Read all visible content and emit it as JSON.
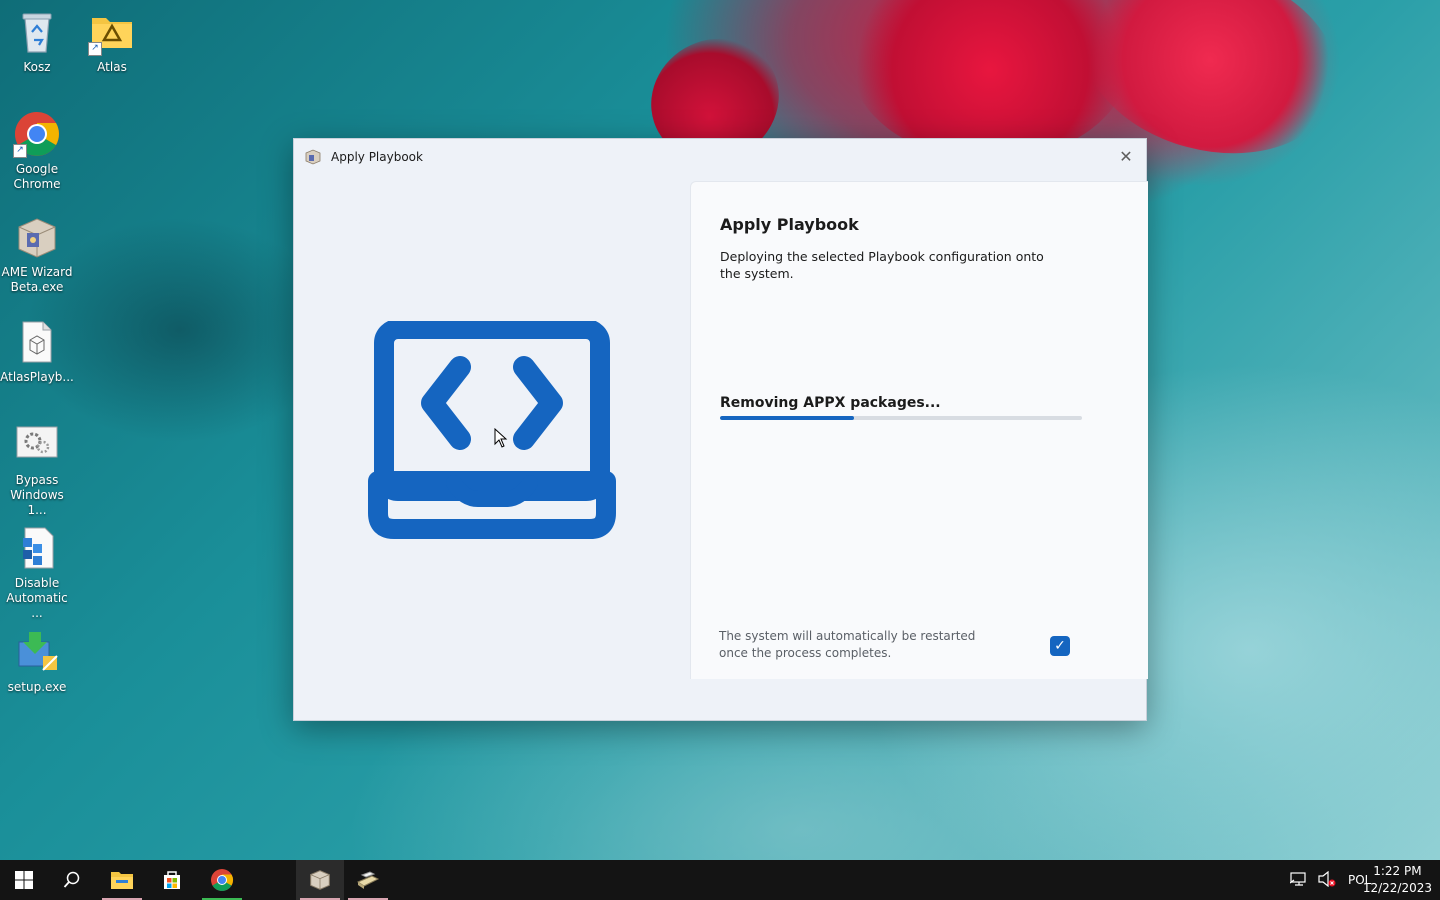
{
  "desktop": {
    "icons": [
      {
        "label": "Kosz",
        "icon": "recycle-bin-icon"
      },
      {
        "label": "Atlas",
        "icon": "folder-icon"
      },
      {
        "label": "Google Chrome",
        "icon": "chrome-icon"
      },
      {
        "label": "AME Wizard Beta.exe",
        "icon": "ame-wizard-icon"
      },
      {
        "label": "AtlasPlayb...",
        "icon": "playbook-file-icon"
      },
      {
        "label": "Bypass Windows 1...",
        "icon": "settings-file-icon"
      },
      {
        "label": "Disable Automatic ...",
        "icon": "registry-file-icon"
      },
      {
        "label": "setup.exe",
        "icon": "setup-icon"
      }
    ]
  },
  "dialog": {
    "window_title": "Apply Playbook",
    "close_glyph": "✕",
    "heading": "Apply Playbook",
    "description": "Deploying the selected Playbook configuration onto the system.",
    "status_text": "Removing APPX packages...",
    "progress_fraction": 0.37,
    "restart_note": "The system will automatically be restarted once the process completes.",
    "restart_checkbox_checked": true,
    "accent_color": "#1565c0"
  },
  "taskbar": {
    "buttons": [
      "start-icon",
      "search-icon",
      "file-explorer-icon",
      "store-icon",
      "chrome-icon",
      "ame-wizard-icon",
      "playbook-tool-icon"
    ],
    "tray": {
      "language": "POL",
      "time": "1:22 PM",
      "date": "12/22/2023"
    }
  }
}
